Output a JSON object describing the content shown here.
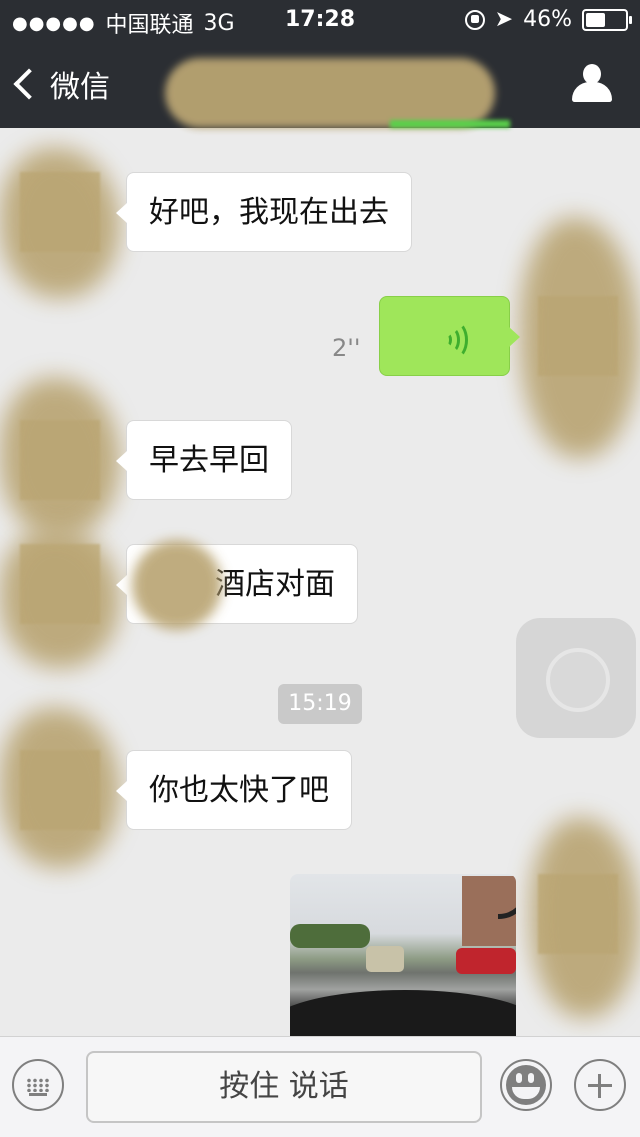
{
  "status_bar": {
    "signal": "●●●●●",
    "carrier": "中国联通",
    "network": "3G",
    "time": "17:28",
    "battery_percent": "46%",
    "battery_level": 0.46
  },
  "nav": {
    "back_label": "微信",
    "title": ""
  },
  "messages": [
    {
      "side": "left",
      "type": "text",
      "text": "好吧，我现在出去"
    },
    {
      "side": "right",
      "type": "voice",
      "duration": "2''"
    },
    {
      "side": "left",
      "type": "text",
      "text": "早去早回"
    },
    {
      "side": "left",
      "type": "text",
      "text": "酒店对面"
    },
    {
      "type": "timestamp",
      "text": "15:19"
    },
    {
      "side": "left",
      "type": "text",
      "text": "你也太快了吧"
    },
    {
      "side": "right",
      "type": "image"
    }
  ],
  "input_bar": {
    "hold_to_talk_label": "按住 说话"
  },
  "colors": {
    "nav_bg": "#2b2e33",
    "chat_bg": "#ebebeb",
    "sent_bubble": "#9fe65a",
    "received_bubble": "#ffffff"
  }
}
